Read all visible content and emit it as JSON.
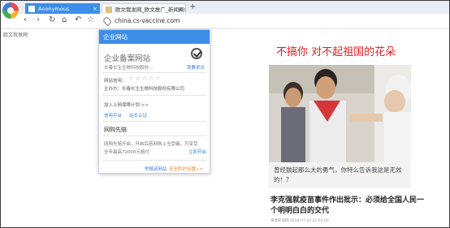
{
  "tabs": [
    {
      "label": "Anonymous",
      "active": true
    },
    {
      "label": "欧文我发网_欧文推广_新闻网站",
      "active": false
    }
  ],
  "nav": {
    "url": "china.cs-vaccine.com"
  },
  "bookmark": {
    "label": "欧文我发网"
  },
  "popup": {
    "header": "企业网站",
    "title": "企业备案网站",
    "company_short": "长春长生生物科技股份...",
    "verify_link": "我要求评",
    "rating_label": "网站信用：",
    "stars": "☆☆☆☆☆",
    "entity": "主办方：长春长生生物科技股份有限公司",
    "join_link": "加入上网保障计划 >>",
    "link_credit": "信用平台",
    "link_check": "站长认证",
    "section_title": "网购先赔",
    "desc_line1": "网购先赔开启，开启后若网购上当受骗，可享受",
    "desc_line2": "全年最高72000元赔付",
    "open_link": "立即开启",
    "report_link": "举报该网站",
    "remind_link": "安全防护设置>>"
  },
  "article": {
    "headline": "不搞你 对不起祖国的花朵",
    "caption": "曾经鼓起那么大的勇气，你特么告诉我这是无效的！？",
    "title": "李克强就疫苗事件作出批示：必须给全国人民一个明明白白的交代",
    "meta": "来源新浪网 2018-07-22 22:03:00"
  },
  "colors": {
    "accent": "#3d8ee8",
    "headline_red": "#e21d1d",
    "link_blue": "#3d7fd6"
  }
}
